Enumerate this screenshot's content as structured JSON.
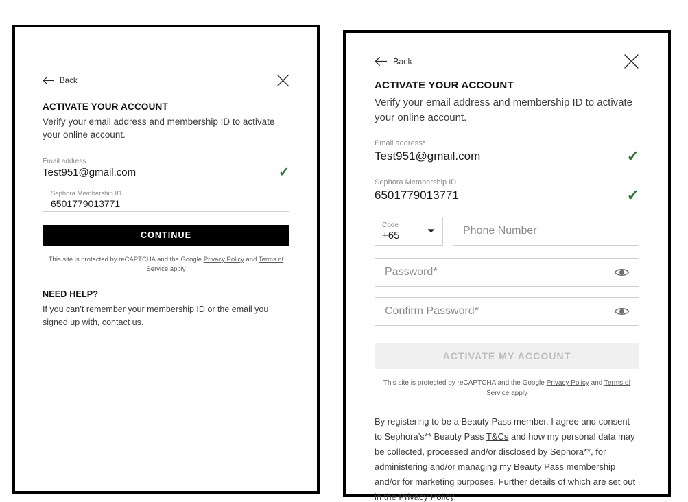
{
  "panels": {
    "left": {
      "back_label": "Back",
      "title": "ACTIVATE YOUR ACCOUNT",
      "subtitle": "Verify your email address and membership ID to activate your online account.",
      "email_label": "Email address",
      "email_value": "Test951@gmail.com",
      "email_check": "✓",
      "member_label": "Sephora Membership ID",
      "member_value": "6501779013771",
      "cta_label": "CONTINUE",
      "recaptcha_prefix": "This site is protected by reCAPTCHA and the Google ",
      "recaptcha_privacy": "Privacy Policy",
      "recaptcha_and": " and ",
      "recaptcha_terms": "Terms of Service",
      "recaptcha_suffix": " apply",
      "help_title": "NEED HELP?",
      "help_text_prefix": "If you can’t remember your membership ID or the email you signed up with, ",
      "help_link": "contact us",
      "help_text_suffix": "."
    },
    "right": {
      "back_label": "Back",
      "title": "ACTIVATE YOUR ACCOUNT",
      "subtitle": "Verify your email address and membership ID to activate your online account.",
      "email_label": "Email address*",
      "email_value": "Test951@gmail.com",
      "email_check": "✓",
      "member_label": "Sephora Membership ID",
      "member_value": "6501779013771",
      "member_check": "✓",
      "code_label": "Code",
      "code_value": "+65",
      "phone_placeholder": "Phone Number",
      "password_placeholder": "Password*",
      "confirm_password_placeholder": "Confirm Password*",
      "cta_label": "ACTIVATE MY ACCOUNT",
      "recaptcha_prefix": "This site is protected by reCAPTCHA and the Google ",
      "recaptcha_privacy": "Privacy Policy",
      "recaptcha_and": " and ",
      "recaptcha_terms": "Terms of Service",
      "recaptcha_suffix": " apply",
      "legal_part1": "By registering to be a Beauty Pass member, I agree and consent to Sephora’s** Beauty Pass ",
      "legal_tcs": "T&Cs",
      "legal_part2": " and how my personal data may be collected, processed and/or disclosed by Sephora**, for administering and/or managing my Beauty Pass membership and/or for marketing purposes. Further details of which are set out in the ",
      "legal_privacy": "Privacy Policy",
      "legal_part3": "."
    }
  },
  "colors": {
    "accent_check": "#2e7233",
    "primary_button_bg": "#000000",
    "disabled_button_bg": "#f0f0f0",
    "disabled_button_text": "#bdbdbd",
    "panel_border": "#000000"
  }
}
